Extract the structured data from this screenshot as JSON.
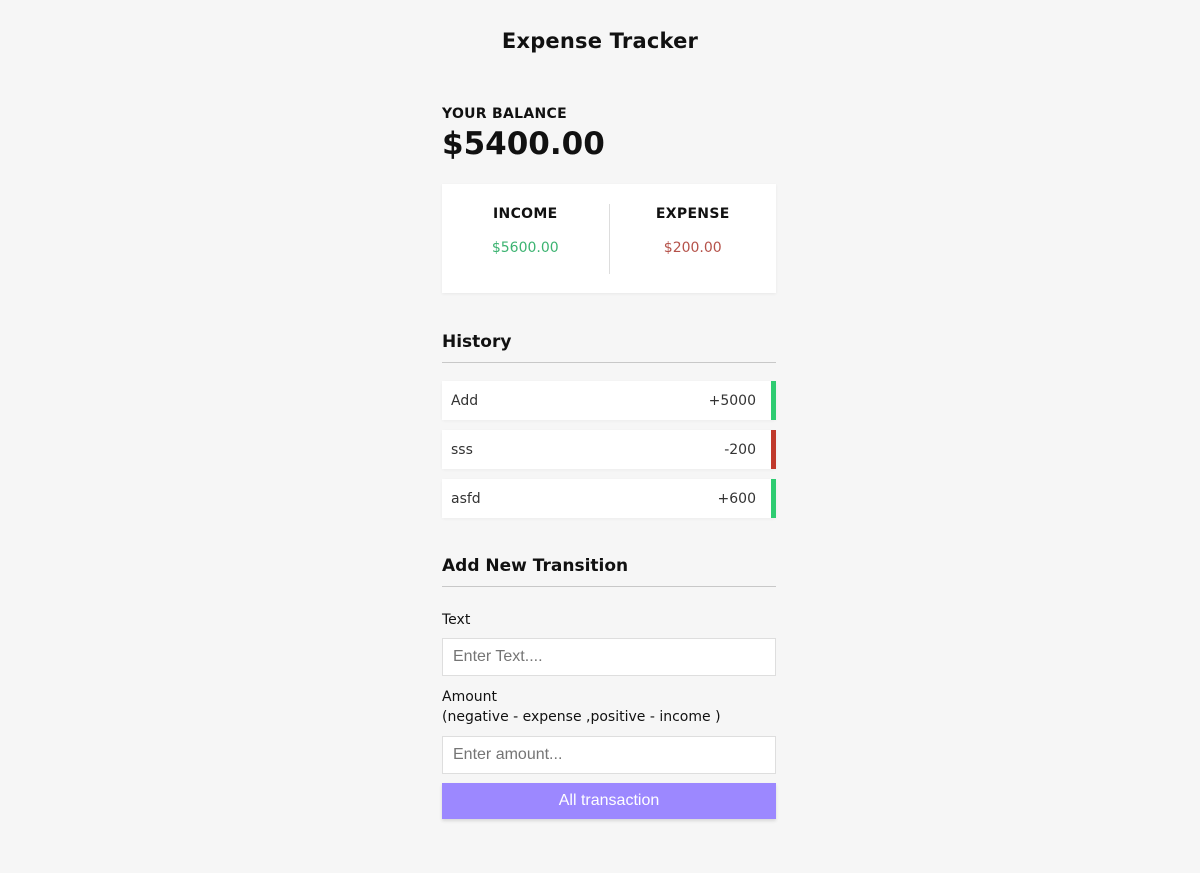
{
  "app": {
    "title": "Expense Tracker"
  },
  "balance": {
    "label": "YOUR BALANCE",
    "value": "$5400.00"
  },
  "summary": {
    "income_label": "INCOME",
    "income_value": "$5600.00",
    "expense_label": "EXPENSE",
    "expense_value": "$200.00"
  },
  "history": {
    "title": "History",
    "items": [
      {
        "text": "Add",
        "amount": "+5000",
        "type": "income"
      },
      {
        "text": "sss",
        "amount": "-200",
        "type": "expense"
      },
      {
        "text": "asfd",
        "amount": "+600",
        "type": "income"
      }
    ]
  },
  "form": {
    "title": "Add New Transition",
    "text_label": "Text",
    "text_placeholder": "Enter Text....",
    "text_value": "",
    "amount_label": "Amount",
    "amount_hint": "(negative - expense ,positive - income )",
    "amount_placeholder": "Enter amount...",
    "amount_value": "",
    "submit_label": "All transaction"
  },
  "colors": {
    "background": "#f6f6f6",
    "income": "#2ecc71",
    "income_text": "#3cb371",
    "expense": "#c0392b",
    "expense_text": "#b5524a",
    "button": "#9c88ff"
  }
}
